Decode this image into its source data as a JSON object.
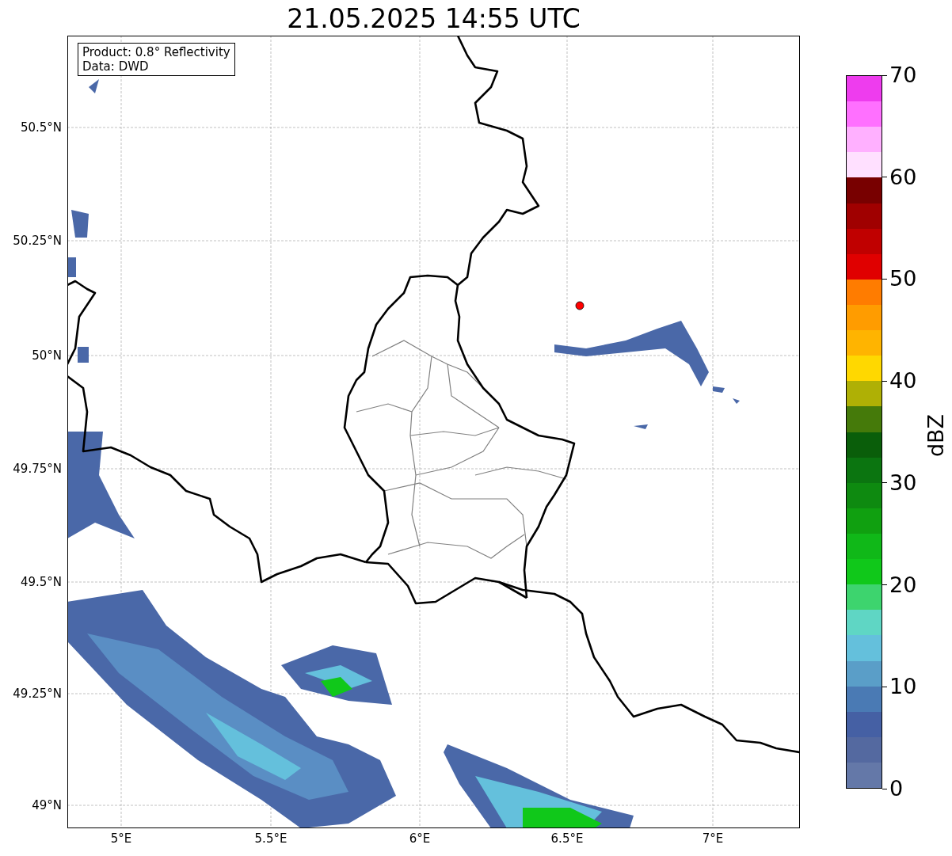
{
  "title": "21.05.2025 14:55 UTC",
  "info_box": [
    "Product: 0.8° Reflectivity",
    "Data: DWD"
  ],
  "map": {
    "x_ticks": [
      "5°E",
      "5.5°E",
      "6°E",
      "6.5°E",
      "7°E"
    ],
    "y_ticks": [
      "50.5°N",
      "50.25°N",
      "50°N",
      "49.75°N",
      "49.5°N",
      "49.25°N",
      "49°N"
    ]
  },
  "colorbar": {
    "label": "dBZ",
    "ticks": [
      "70",
      "60",
      "50",
      "40",
      "30",
      "20",
      "10",
      "0"
    ],
    "bins": [
      {
        "color": "#ee3cee"
      },
      {
        "color": "#ff70ff"
      },
      {
        "color": "#ffb0ff"
      },
      {
        "color": "#ffe0ff"
      },
      {
        "color": "#780000"
      },
      {
        "color": "#a00000"
      },
      {
        "color": "#c00000"
      },
      {
        "color": "#e00000"
      },
      {
        "color": "#ff7c00"
      },
      {
        "color": "#ff9c00"
      },
      {
        "color": "#ffb400"
      },
      {
        "color": "#ffd800"
      },
      {
        "color": "#afb005"
      },
      {
        "color": "#457a0a"
      },
      {
        "color": "#0a5e0a"
      },
      {
        "color": "#0b7510"
      },
      {
        "color": "#0e8a10"
      },
      {
        "color": "#10a010"
      },
      {
        "color": "#10b818"
      },
      {
        "color": "#10c81a"
      },
      {
        "color": "#3dd46e"
      },
      {
        "color": "#5fd6c4"
      },
      {
        "color": "#64c0dc"
      },
      {
        "color": "#5a9ec8"
      },
      {
        "color": "#4a7ab4"
      },
      {
        "color": "#4560a4"
      },
      {
        "color": "#5469a0"
      },
      {
        "color": "#6478a8"
      }
    ]
  }
}
